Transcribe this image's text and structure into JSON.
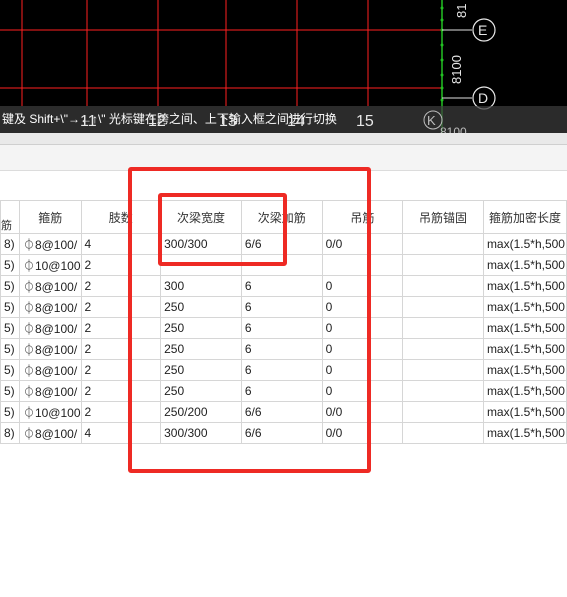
{
  "cad": {
    "axis_labels": [
      "81",
      "E",
      "8100",
      "D",
      "8100",
      "11",
      "12",
      "13",
      "14",
      "15",
      "K"
    ]
  },
  "hint": {
    "text": "键及 Shift+\\\"→←↑\\\" 光标键在跨之间、上下输入框之间进行切换"
  },
  "table": {
    "headers": [
      "筋",
      "箍筋",
      "肢数",
      "次梁宽度",
      "次梁加筋",
      "吊筋",
      "吊筋锚固",
      "箍筋加密长度"
    ],
    "rows": [
      [
        "8)",
        "⏀8@100/",
        "4",
        "300/300",
        "6/6",
        "0/0",
        "",
        "max(1.5*h,500"
      ],
      [
        "5)",
        "⏀10@100",
        "2",
        "",
        "",
        "",
        "",
        "max(1.5*h,500"
      ],
      [
        "5)",
        "⏀8@100/",
        "2",
        "300",
        "6",
        "0",
        "",
        "max(1.5*h,500"
      ],
      [
        "5)",
        "⏀8@100/",
        "2",
        "250",
        "6",
        "0",
        "",
        "max(1.5*h,500"
      ],
      [
        "5)",
        "⏀8@100/",
        "2",
        "250",
        "6",
        "0",
        "",
        "max(1.5*h,500"
      ],
      [
        "5)",
        "⏀8@100/",
        "2",
        "250",
        "6",
        "0",
        "",
        "max(1.5*h,500"
      ],
      [
        "5)",
        "⏀8@100/",
        "2",
        "250",
        "6",
        "0",
        "",
        "max(1.5*h,500"
      ],
      [
        "5)",
        "⏀8@100/",
        "2",
        "250",
        "6",
        "0",
        "",
        "max(1.5*h,500"
      ],
      [
        "5)",
        "⏀10@100",
        "2",
        "250/200",
        "6/6",
        "0/0",
        "",
        "max(1.5*h,500"
      ],
      [
        "8)",
        "⏀8@100/",
        "4",
        "300/300",
        "6/6",
        "0/0",
        "",
        "max(1.5*h,500"
      ]
    ]
  },
  "colors": {
    "annotation": "#ee2a24",
    "grid_line": "#ff2020",
    "axis_line": "#22c022"
  }
}
